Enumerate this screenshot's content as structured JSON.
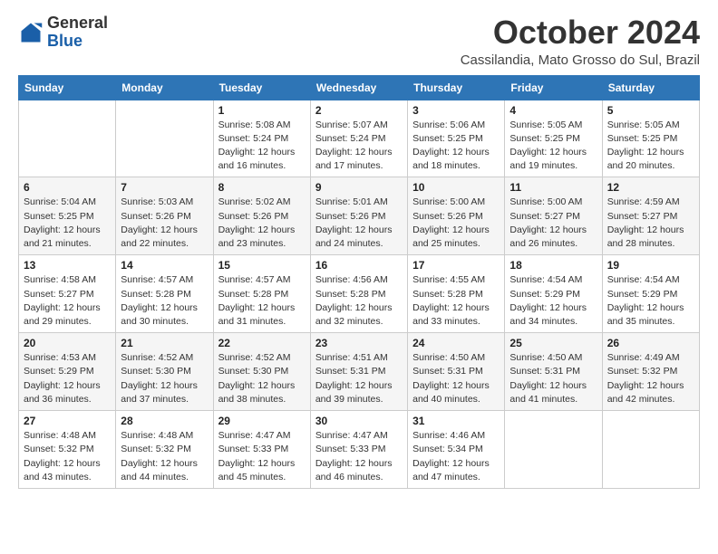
{
  "logo": {
    "general": "General",
    "blue": "Blue"
  },
  "header": {
    "month": "October 2024",
    "location": "Cassilandia, Mato Grosso do Sul, Brazil"
  },
  "weekdays": [
    "Sunday",
    "Monday",
    "Tuesday",
    "Wednesday",
    "Thursday",
    "Friday",
    "Saturday"
  ],
  "weeks": [
    [
      {
        "day": "",
        "sunrise": "",
        "sunset": "",
        "daylight": ""
      },
      {
        "day": "",
        "sunrise": "",
        "sunset": "",
        "daylight": ""
      },
      {
        "day": "1",
        "sunrise": "Sunrise: 5:08 AM",
        "sunset": "Sunset: 5:24 PM",
        "daylight": "Daylight: 12 hours and 16 minutes."
      },
      {
        "day": "2",
        "sunrise": "Sunrise: 5:07 AM",
        "sunset": "Sunset: 5:24 PM",
        "daylight": "Daylight: 12 hours and 17 minutes."
      },
      {
        "day": "3",
        "sunrise": "Sunrise: 5:06 AM",
        "sunset": "Sunset: 5:25 PM",
        "daylight": "Daylight: 12 hours and 18 minutes."
      },
      {
        "day": "4",
        "sunrise": "Sunrise: 5:05 AM",
        "sunset": "Sunset: 5:25 PM",
        "daylight": "Daylight: 12 hours and 19 minutes."
      },
      {
        "day": "5",
        "sunrise": "Sunrise: 5:05 AM",
        "sunset": "Sunset: 5:25 PM",
        "daylight": "Daylight: 12 hours and 20 minutes."
      }
    ],
    [
      {
        "day": "6",
        "sunrise": "Sunrise: 5:04 AM",
        "sunset": "Sunset: 5:25 PM",
        "daylight": "Daylight: 12 hours and 21 minutes."
      },
      {
        "day": "7",
        "sunrise": "Sunrise: 5:03 AM",
        "sunset": "Sunset: 5:26 PM",
        "daylight": "Daylight: 12 hours and 22 minutes."
      },
      {
        "day": "8",
        "sunrise": "Sunrise: 5:02 AM",
        "sunset": "Sunset: 5:26 PM",
        "daylight": "Daylight: 12 hours and 23 minutes."
      },
      {
        "day": "9",
        "sunrise": "Sunrise: 5:01 AM",
        "sunset": "Sunset: 5:26 PM",
        "daylight": "Daylight: 12 hours and 24 minutes."
      },
      {
        "day": "10",
        "sunrise": "Sunrise: 5:00 AM",
        "sunset": "Sunset: 5:26 PM",
        "daylight": "Daylight: 12 hours and 25 minutes."
      },
      {
        "day": "11",
        "sunrise": "Sunrise: 5:00 AM",
        "sunset": "Sunset: 5:27 PM",
        "daylight": "Daylight: 12 hours and 26 minutes."
      },
      {
        "day": "12",
        "sunrise": "Sunrise: 4:59 AM",
        "sunset": "Sunset: 5:27 PM",
        "daylight": "Daylight: 12 hours and 28 minutes."
      }
    ],
    [
      {
        "day": "13",
        "sunrise": "Sunrise: 4:58 AM",
        "sunset": "Sunset: 5:27 PM",
        "daylight": "Daylight: 12 hours and 29 minutes."
      },
      {
        "day": "14",
        "sunrise": "Sunrise: 4:57 AM",
        "sunset": "Sunset: 5:28 PM",
        "daylight": "Daylight: 12 hours and 30 minutes."
      },
      {
        "day": "15",
        "sunrise": "Sunrise: 4:57 AM",
        "sunset": "Sunset: 5:28 PM",
        "daylight": "Daylight: 12 hours and 31 minutes."
      },
      {
        "day": "16",
        "sunrise": "Sunrise: 4:56 AM",
        "sunset": "Sunset: 5:28 PM",
        "daylight": "Daylight: 12 hours and 32 minutes."
      },
      {
        "day": "17",
        "sunrise": "Sunrise: 4:55 AM",
        "sunset": "Sunset: 5:28 PM",
        "daylight": "Daylight: 12 hours and 33 minutes."
      },
      {
        "day": "18",
        "sunrise": "Sunrise: 4:54 AM",
        "sunset": "Sunset: 5:29 PM",
        "daylight": "Daylight: 12 hours and 34 minutes."
      },
      {
        "day": "19",
        "sunrise": "Sunrise: 4:54 AM",
        "sunset": "Sunset: 5:29 PM",
        "daylight": "Daylight: 12 hours and 35 minutes."
      }
    ],
    [
      {
        "day": "20",
        "sunrise": "Sunrise: 4:53 AM",
        "sunset": "Sunset: 5:29 PM",
        "daylight": "Daylight: 12 hours and 36 minutes."
      },
      {
        "day": "21",
        "sunrise": "Sunrise: 4:52 AM",
        "sunset": "Sunset: 5:30 PM",
        "daylight": "Daylight: 12 hours and 37 minutes."
      },
      {
        "day": "22",
        "sunrise": "Sunrise: 4:52 AM",
        "sunset": "Sunset: 5:30 PM",
        "daylight": "Daylight: 12 hours and 38 minutes."
      },
      {
        "day": "23",
        "sunrise": "Sunrise: 4:51 AM",
        "sunset": "Sunset: 5:31 PM",
        "daylight": "Daylight: 12 hours and 39 minutes."
      },
      {
        "day": "24",
        "sunrise": "Sunrise: 4:50 AM",
        "sunset": "Sunset: 5:31 PM",
        "daylight": "Daylight: 12 hours and 40 minutes."
      },
      {
        "day": "25",
        "sunrise": "Sunrise: 4:50 AM",
        "sunset": "Sunset: 5:31 PM",
        "daylight": "Daylight: 12 hours and 41 minutes."
      },
      {
        "day": "26",
        "sunrise": "Sunrise: 4:49 AM",
        "sunset": "Sunset: 5:32 PM",
        "daylight": "Daylight: 12 hours and 42 minutes."
      }
    ],
    [
      {
        "day": "27",
        "sunrise": "Sunrise: 4:48 AM",
        "sunset": "Sunset: 5:32 PM",
        "daylight": "Daylight: 12 hours and 43 minutes."
      },
      {
        "day": "28",
        "sunrise": "Sunrise: 4:48 AM",
        "sunset": "Sunset: 5:32 PM",
        "daylight": "Daylight: 12 hours and 44 minutes."
      },
      {
        "day": "29",
        "sunrise": "Sunrise: 4:47 AM",
        "sunset": "Sunset: 5:33 PM",
        "daylight": "Daylight: 12 hours and 45 minutes."
      },
      {
        "day": "30",
        "sunrise": "Sunrise: 4:47 AM",
        "sunset": "Sunset: 5:33 PM",
        "daylight": "Daylight: 12 hours and 46 minutes."
      },
      {
        "day": "31",
        "sunrise": "Sunrise: 4:46 AM",
        "sunset": "Sunset: 5:34 PM",
        "daylight": "Daylight: 12 hours and 47 minutes."
      },
      {
        "day": "",
        "sunrise": "",
        "sunset": "",
        "daylight": ""
      },
      {
        "day": "",
        "sunrise": "",
        "sunset": "",
        "daylight": ""
      }
    ]
  ]
}
